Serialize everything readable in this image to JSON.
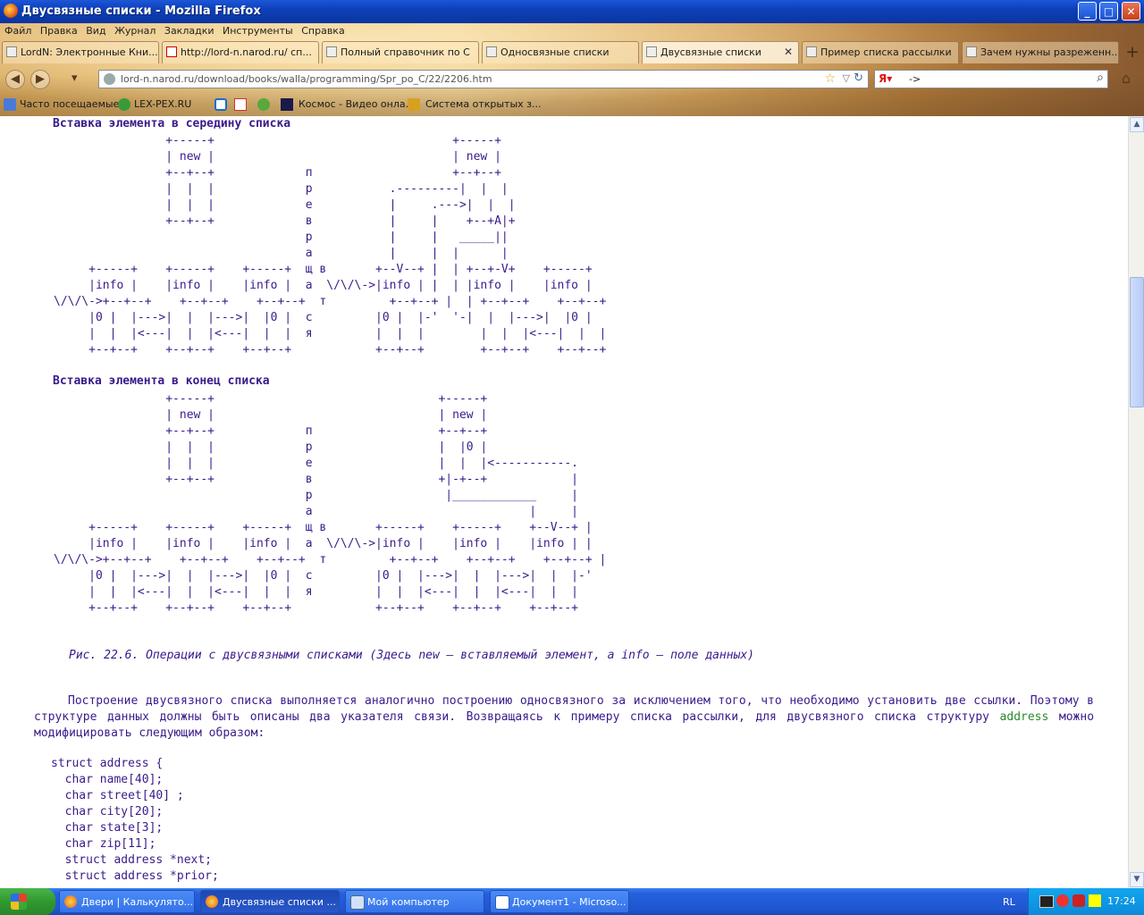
{
  "window": {
    "title": "Двусвязные списки - Mozilla Firefox",
    "controls": {
      "minimize": "_",
      "maximize": "□",
      "close": "✕"
    }
  },
  "menu": [
    "Файл",
    "Правка",
    "Вид",
    "Журнал",
    "Закладки",
    "Инструменты",
    "Справка"
  ],
  "tabs": [
    {
      "label": "LordN: Электронные Кни...",
      "icon": "page-icon"
    },
    {
      "label": "http://lord-n.narod.ru/ сп...",
      "icon": "yandex-icon"
    },
    {
      "label": "Полный справочник по С",
      "icon": "page-icon"
    },
    {
      "label": "Односвязные списки",
      "icon": "page-icon"
    },
    {
      "label": "Двусвязные списки",
      "icon": "page-icon",
      "active": true
    },
    {
      "label": "Пример списка рассылки",
      "icon": "page-icon"
    },
    {
      "label": "Зачем нужны разреженн...",
      "icon": "page-icon"
    }
  ],
  "nav": {
    "url": "lord-n.narod.ru/download/books/walla/programming/Spr_po_C/22/2206.htm",
    "search_value": "->",
    "new_tab": "+"
  },
  "bookmarks": [
    {
      "label": "Часто посещаемые"
    },
    {
      "label": "LEX-PEX.RU"
    },
    {
      "label": ""
    },
    {
      "label": ""
    },
    {
      "label": ""
    },
    {
      "label": "Космос - Видео онла..."
    },
    {
      "label": "Система открытых з..."
    }
  ],
  "content": {
    "heading1": "Вставка элемента в середину списка",
    "diagram1": "                +-----+                                  +-----+\n                | new |                                  | new |\n                +--+--+             п                    +--+--+\n                |  |  |             р           .---------|  |  |\n                |  |  |             е           |     .--->|  |  |\n                +--+--+             в           |     |    +--+A|+\n                                    р           |     |   _____||\n                                    а           |     |  |      |\n     +-----+    +-----+    +-----+  щ в       +--V--+ |  | +--+-V+    +-----+\n     |info |    |info |    |info |  а  \\/\\/\\->|info | |  | |info |    |info |\n\\/\\/\\->+--+--+    +--+--+    +--+--+  т         +--+--+ |  | +--+--+    +--+--+\n     |0 |  |--->|  |  |--->|  |0 |  с         |0 |  |-'  '-|  |  |--->|  |0 |\n     |  |  |<---|  |  |<---|  |  |  я         |  |  |        |  |  |<---|  |  |\n     +--+--+    +--+--+    +--+--+            +--+--+        +--+--+    +--+--+",
    "heading2": "Вставка элемента в конец списка",
    "diagram2": "                +-----+                                +-----+\n                | new |                                | new |\n                +--+--+             п                  +--+--+\n                |  |  |             р                  |  |0 |\n                |  |  |             е                  |  |  |<-----------.\n                +--+--+             в                  +|-+--+            |\n                                    р                   |____________     |\n                                    а                               |     |\n     +-----+    +-----+    +-----+  щ в       +-----+    +-----+    +--V--+ |\n     |info |    |info |    |info |  а  \\/\\/\\->|info |    |info |    |info | |\n\\/\\/\\->+--+--+    +--+--+    +--+--+  т         +--+--+    +--+--+    +--+--+ |\n     |0 |  |--->|  |  |--->|  |0 |  с         |0 |  |--->|  |  |--->|  |  |-'\n     |  |  |<---|  |  |<---|  |  |  я         |  |  |<---|  |  |<---|  |  |\n     +--+--+    +--+--+    +--+--+            +--+--+    +--+--+    +--+--+",
    "caption": "Рис. 22.6. Операции с двусвязными списками (Здесь new — вставляемый элемент, а info — поле данных)",
    "paragraph_before": "Построение двусвязного списка выполняется аналогично построению односвязного за исключением того, что необходимо установить две ссылки. Поэтому в структуре данных должны быть описаны два указателя связи. Возвращаясь к примеру списка рассылки, для двусвязного списка структуру",
    "paragraph_keyword": "address",
    "paragraph_after": "можно модифицировать следующим образом:",
    "code": "struct address {\n  char name[40];\n  char street[40] ;\n  char city[20];\n  char state[3];\n  char zip[11];\n  struct address *next;\n  struct address *prior;"
  },
  "taskbar": {
    "start_label": "",
    "buttons": [
      {
        "label": "Двери | Калькулято..."
      },
      {
        "label": "Двусвязные списки ...",
        "active": true
      },
      {
        "label": "Мой компьютер"
      },
      {
        "label": "Документ1 - Microso..."
      }
    ],
    "lang": "RL",
    "clock": "17:24"
  }
}
